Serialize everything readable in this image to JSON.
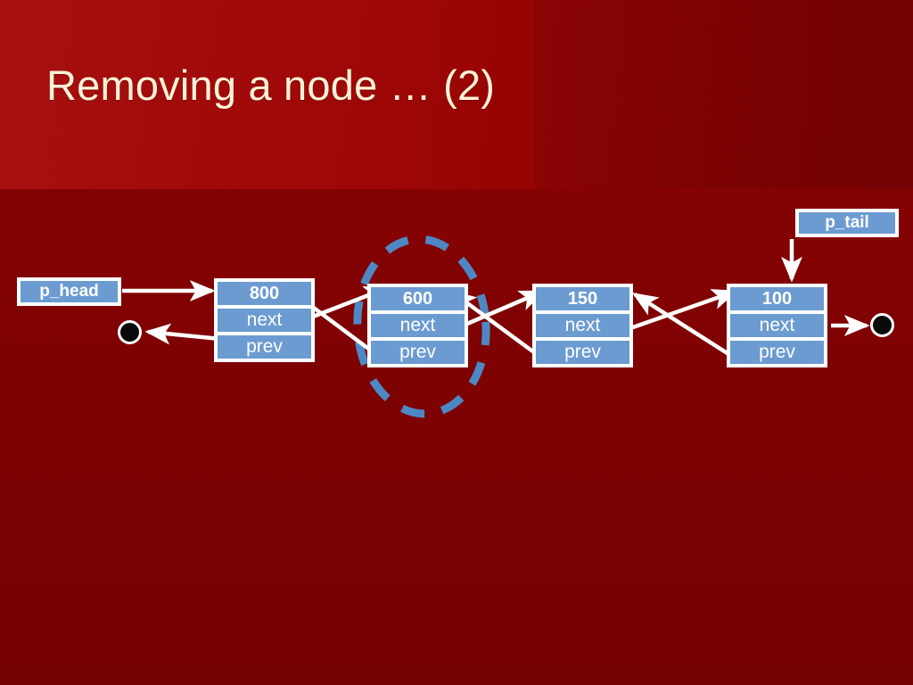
{
  "slide": {
    "title": "Removing a node … (2)",
    "background_top_color": "#9d0505",
    "background_bottom_color": "#7d0202",
    "title_color": "#fdf2d7"
  },
  "diagram": {
    "kind": "doubly-linked-list",
    "node_fill_color": "#6b9bd1",
    "node_border_color": "#ffffff",
    "arrow_color": "#ffffff",
    "highlight_color": "#4d88c4",
    "field_labels": {
      "next": "next",
      "prev": "prev"
    },
    "pointers": [
      {
        "name": "p_head",
        "label": "p_head"
      },
      {
        "name": "p_tail",
        "label": "p_tail"
      }
    ],
    "nodes": [
      {
        "value": "800",
        "next": "next",
        "prev": "prev"
      },
      {
        "value": "600",
        "next": "next",
        "prev": "prev",
        "highlighted": true
      },
      {
        "value": "150",
        "next": "next",
        "prev": "prev"
      },
      {
        "value": "100",
        "next": "next",
        "prev": "prev"
      }
    ],
    "null_markers": [
      {
        "name": "head-prev-null"
      },
      {
        "name": "tail-next-null"
      }
    ],
    "highlight": {
      "shape": "dashed-ellipse",
      "target_node_value": "600"
    }
  }
}
